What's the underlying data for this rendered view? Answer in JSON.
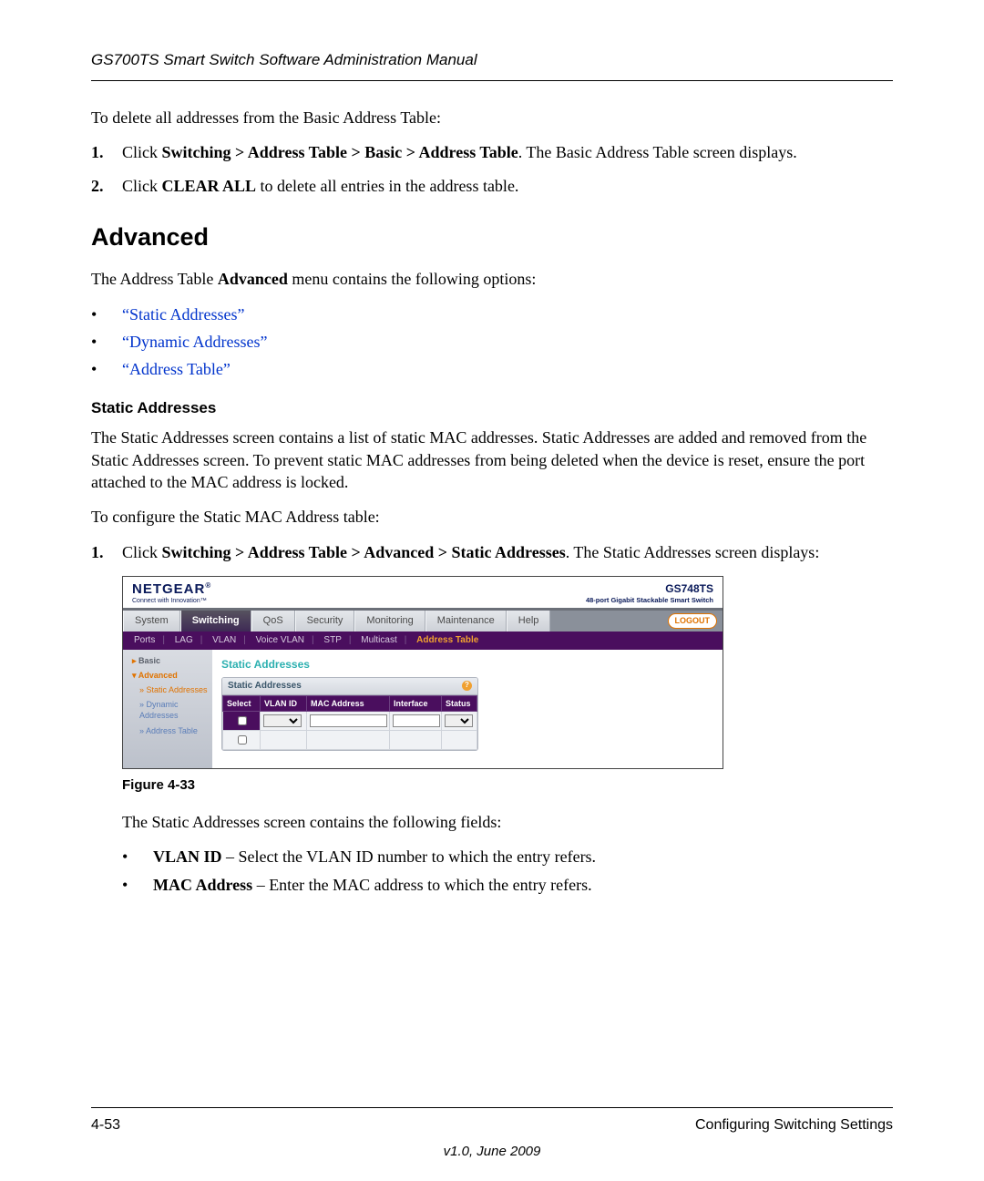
{
  "header_title": "GS700TS Smart Switch Software Administration Manual",
  "intro_delete": "To delete all addresses from the Basic Address Table:",
  "steps_delete": [
    {
      "num": "1.",
      "prefix": "Click ",
      "bold": "Switching > Address Table > Basic > Address Table",
      "suffix": ". The Basic Address Table screen displays."
    },
    {
      "num": "2.",
      "prefix": "Click ",
      "bold": "CLEAR ALL",
      "suffix": " to delete all entries in the address table."
    }
  ],
  "section_heading": "Advanced",
  "advanced_intro_prefix": "The Address Table ",
  "advanced_intro_bold": "Advanced",
  "advanced_intro_suffix": " menu contains the following options:",
  "advanced_links": [
    "“Static Addresses”",
    "“Dynamic Addresses”",
    "“Address Table”"
  ],
  "subsection_heading": "Static Addresses",
  "static_para": "The Static Addresses screen contains a list of static MAC addresses. Static Addresses are added and removed from the Static Addresses screen. To prevent static MAC addresses from being deleted when the device is reset, ensure the port attached to the MAC address is locked.",
  "configure_intro": "To configure the Static MAC Address table:",
  "steps_configure": [
    {
      "num": "1.",
      "prefix": "Click ",
      "bold": "Switching > Address Table > Advanced > Static Addresses",
      "suffix": ". The Static Addresses screen displays:"
    }
  ],
  "screenshot": {
    "brand": "NETGEAR",
    "brand_reg": "®",
    "brand_tag": "Connect with Innovation™",
    "model": "GS748TS",
    "model_desc": "48-port Gigabit Stackable Smart Switch",
    "nav": [
      "System",
      "Switching",
      "QoS",
      "Security",
      "Monitoring",
      "Maintenance",
      "Help"
    ],
    "active_nav": "Switching",
    "logout": "LOGOUT",
    "subnav_items": [
      "Ports",
      "LAG",
      "VLAN",
      "Voice VLAN",
      "STP",
      "Multicast",
      "Address Table"
    ],
    "active_subnav": "Address Table",
    "leftnav": {
      "basic": "Basic",
      "advanced": "Advanced",
      "items": [
        "Static Addresses",
        "Dynamic Addresses",
        "Address Table"
      ],
      "active_item": "Static Addresses"
    },
    "panel_main_title": "Static Addresses",
    "panel_inner_title": "Static Addresses",
    "columns": [
      "Select",
      "VLAN ID",
      "MAC Address",
      "Interface",
      "Status"
    ]
  },
  "figure_caption": "Figure 4-33",
  "fields_intro": "The Static Addresses screen contains the following fields:",
  "fields": [
    {
      "name": "VLAN ID",
      "desc": " – Select the VLAN ID number to which the entry refers."
    },
    {
      "name": "MAC Address",
      "desc": " – Enter the MAC address to which the entry refers."
    }
  ],
  "footer_left": "4-53",
  "footer_right": "Configuring Switching Settings",
  "version": "v1.0, June 2009"
}
